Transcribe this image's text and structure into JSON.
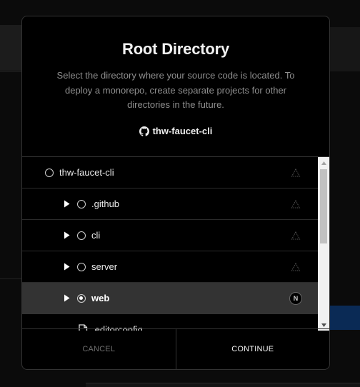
{
  "modal": {
    "title": "Root Directory",
    "description": "Select the directory where your source code is located. To deploy a monorepo, create separate projects for other directories in the future.",
    "repo": {
      "icon": "github-icon",
      "name": "thw-faucet-cli"
    }
  },
  "tree": {
    "root": {
      "label": "thw-faucet-cli",
      "framework_icon": "vercel-triangle-icon"
    },
    "folders": [
      {
        "label": ".github",
        "framework_icon": "vercel-triangle-icon",
        "selected": false
      },
      {
        "label": "cli",
        "framework_icon": "vercel-triangle-icon",
        "selected": false
      },
      {
        "label": "server",
        "framework_icon": "vercel-triangle-icon",
        "selected": false
      },
      {
        "label": "web",
        "framework_icon": "nextjs-icon",
        "framework_badge": "N",
        "selected": true
      }
    ],
    "files": [
      {
        "label": ".editorconfig",
        "icon": "file-icon"
      }
    ]
  },
  "footer": {
    "cancel_label": "CANCEL",
    "continue_label": "CONTINUE"
  }
}
